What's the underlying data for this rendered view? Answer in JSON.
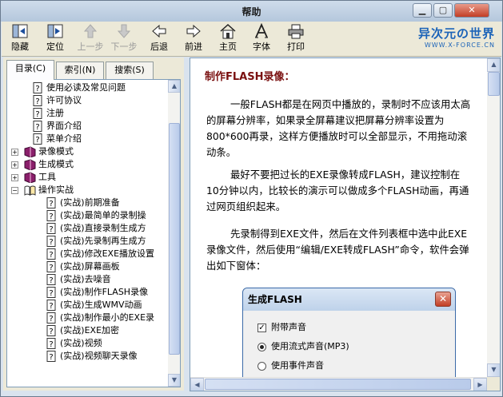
{
  "window": {
    "title": "帮助"
  },
  "toolbar": {
    "buttons": [
      {
        "label": "隐藏",
        "icon": "hide-pane-icon",
        "enabled": true
      },
      {
        "label": "定位",
        "icon": "locate-icon",
        "enabled": true
      },
      {
        "label": "上一步",
        "icon": "up-arrow-icon",
        "enabled": false
      },
      {
        "label": "下一步",
        "icon": "down-arrow-icon",
        "enabled": false
      },
      {
        "label": "后退",
        "icon": "back-arrow-icon",
        "enabled": true
      },
      {
        "label": "前进",
        "icon": "forward-arrow-icon",
        "enabled": true
      },
      {
        "label": "主页",
        "icon": "home-icon",
        "enabled": true
      },
      {
        "label": "字体",
        "icon": "font-icon",
        "enabled": true
      },
      {
        "label": "打印",
        "icon": "printer-icon",
        "enabled": true
      }
    ]
  },
  "brand": {
    "name": "异次元の世界",
    "url": "WWW.X-FORCE.CN"
  },
  "tabs": [
    {
      "label": "目录(C)",
      "active": true
    },
    {
      "label": "索引(N)",
      "active": false
    },
    {
      "label": "搜索(S)",
      "active": false
    }
  ],
  "tree": [
    {
      "label": "使用必读及常见问题",
      "type": "page",
      "level": 1
    },
    {
      "label": "许可协议",
      "type": "page",
      "level": 1
    },
    {
      "label": "注册",
      "type": "page",
      "level": 1
    },
    {
      "label": "界面介绍",
      "type": "page",
      "level": 1
    },
    {
      "label": "菜单介绍",
      "type": "page",
      "level": 1
    },
    {
      "label": "录像模式",
      "type": "book",
      "level": 0,
      "expander": "+"
    },
    {
      "label": "生成模式",
      "type": "book",
      "level": 0,
      "expander": "+"
    },
    {
      "label": "工具",
      "type": "book",
      "level": 0,
      "expander": "+"
    },
    {
      "label": "操作实战",
      "type": "openbook",
      "level": 0,
      "expander": "−"
    },
    {
      "label": "(实战)前期准备",
      "type": "page",
      "level": 2
    },
    {
      "label": "(实战)最简单的录制操",
      "type": "page",
      "level": 2
    },
    {
      "label": "(实战)直接录制生成方",
      "type": "page",
      "level": 2
    },
    {
      "label": "(实战)先录制再生成方",
      "type": "page",
      "level": 2
    },
    {
      "label": "(实战)修改EXE播放设置",
      "type": "page",
      "level": 2
    },
    {
      "label": "(实战)屏幕画板",
      "type": "page",
      "level": 2
    },
    {
      "label": "(实战)去噪音",
      "type": "page",
      "level": 2
    },
    {
      "label": "(实战)制作FLASH录像",
      "type": "page",
      "level": 2
    },
    {
      "label": "(实战)生成WMV动画",
      "type": "page",
      "level": 2
    },
    {
      "label": "(实战)制作最小的EXE录",
      "type": "page",
      "level": 2
    },
    {
      "label": "(实战)EXE加密",
      "type": "page",
      "level": 2
    },
    {
      "label": "(实战)视频",
      "type": "page",
      "level": 2
    },
    {
      "label": "(实战)视频聊天录像",
      "type": "page",
      "level": 2
    }
  ],
  "article": {
    "heading": "制作FLASH录像：",
    "paragraphs": [
      "一般FLASH都是在网页中播放的，录制时不应该用太高的屏幕分辨率，如果录全屏幕建议把屏幕分辨率设置为800*600再录，这样方便播放时可以全部显示，不用拖动滚动条。",
      "最好不要把过长的EXE录像转成FLASH，建议控制在10分钟以内，比较长的演示可以做成多个FLASH动画，再通过网页组织起来。",
      "先录制得到EXE文件，然后在文件列表框中选中此EXE录像文件，然后使用“编辑/EXE转成FLASH”命令，软件会弹出如下窗体："
    ]
  },
  "dialog": {
    "title": "生成FLASH",
    "options": [
      {
        "label": "附带声音",
        "kind": "checkbox",
        "checked": true
      },
      {
        "label": "使用流式声音(MP3)",
        "kind": "radio",
        "checked": true
      },
      {
        "label": "使用事件声音",
        "kind": "radio",
        "checked": false
      }
    ]
  }
}
